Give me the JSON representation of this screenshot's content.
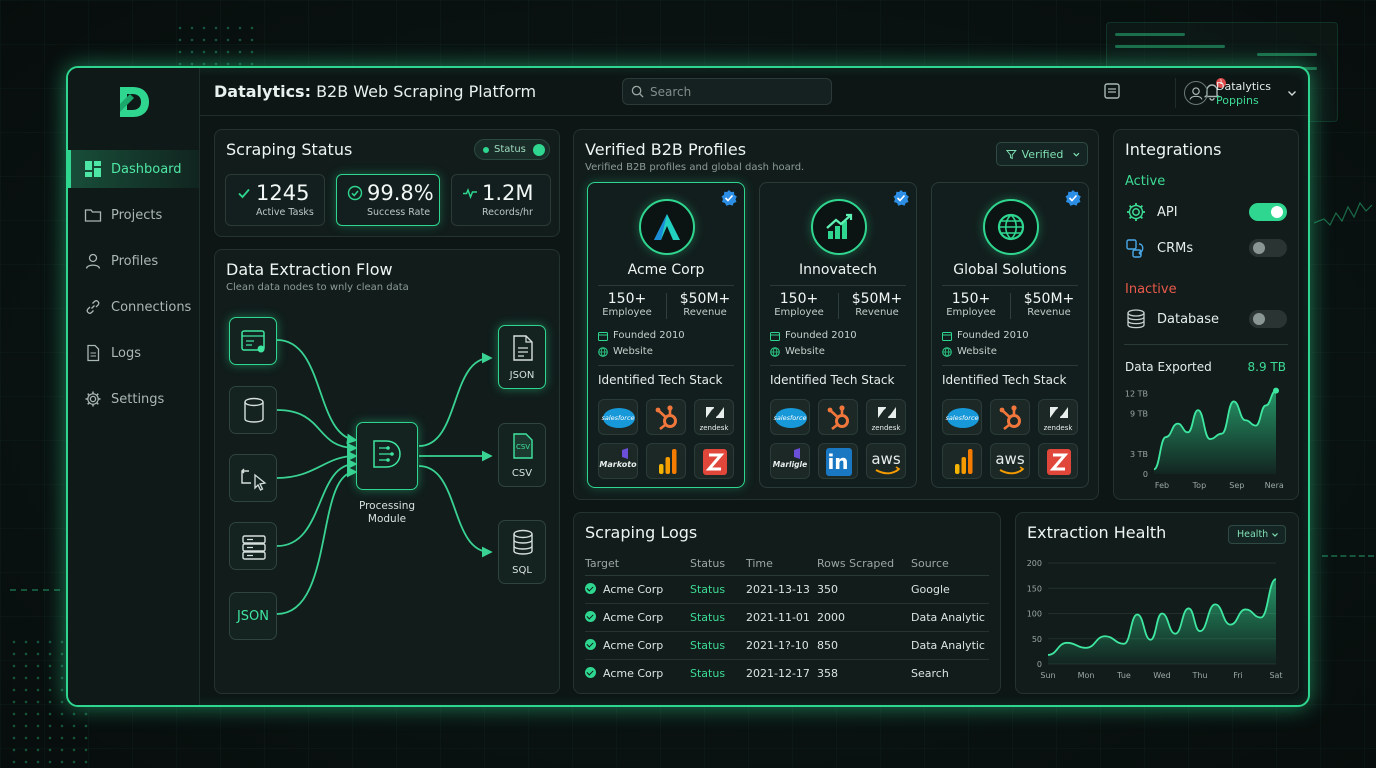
{
  "app": {
    "brand": "Datalytics:",
    "title": "B2B Web Scraping Platform",
    "search_placeholder": "Search",
    "notification_count": "1",
    "user_name": "Datalytics",
    "user_sub": "Poppins"
  },
  "colors": {
    "accent": "#2fd68f",
    "danger": "#e04a4a",
    "panel": "#111c1b"
  },
  "sidebar": {
    "items": [
      {
        "label": "Dashboard",
        "icon": "dashboard-icon",
        "active": true
      },
      {
        "label": "Projects",
        "icon": "folder-icon"
      },
      {
        "label": "Profiles",
        "icon": "user-icon"
      },
      {
        "label": "Connections",
        "icon": "link-icon"
      },
      {
        "label": "Logs",
        "icon": "document-icon"
      },
      {
        "label": "Settings",
        "icon": "gear-icon"
      }
    ]
  },
  "scraping_status": {
    "title": "Scraping Status",
    "pill_label": "Status",
    "stats": [
      {
        "value": "1245",
        "label": "Active Tasks",
        "icon": "check-icon"
      },
      {
        "value": "99.8%",
        "label": "Success Rate",
        "icon": "check-circle-icon"
      },
      {
        "value": "1.2M",
        "label": "Records/hr",
        "icon": "pulse-icon"
      }
    ]
  },
  "flow": {
    "title": "Data Extraction Flow",
    "subtitle": "Clean data nodes to wnly clean data",
    "sources": [
      {
        "icon": "browser-code-icon"
      },
      {
        "icon": "database-icon"
      },
      {
        "icon": "cursor-icon"
      },
      {
        "icon": "server-icon"
      },
      {
        "icon": "json-text-icon",
        "text": "JSON"
      }
    ],
    "processor": {
      "label_line1": "Processing",
      "label_line2": "Module"
    },
    "outputs": [
      {
        "label": "JSON",
        "icon": "file-icon"
      },
      {
        "label": "CSV",
        "icon": "csv-file-icon",
        "badge": "CSV"
      },
      {
        "label": "SQL",
        "icon": "database-icon"
      }
    ]
  },
  "profiles": {
    "title": "Verified B2B Profiles",
    "subtitle": "Verified B2B profiles and global dash hoard.",
    "filter_label": "Verified",
    "stack_title": "Identified Tech Stack",
    "cards": [
      {
        "name": "Acme Corp",
        "logo": "acme-a-icon",
        "employees": "150+",
        "employees_label": "Employee",
        "revenue": "$50M+",
        "revenue_label": "Revenue",
        "founded": "Founded 2010",
        "website": "Website",
        "stack": [
          "salesforce",
          "hubspot",
          "zendesk",
          "marketo",
          "analytics",
          "zapier"
        ]
      },
      {
        "name": "Innovatech",
        "logo": "growth-chart-icon",
        "employees": "150+",
        "employees_label": "Employee",
        "revenue": "$50M+",
        "revenue_label": "Revenue",
        "founded": "Founded 2010",
        "website": "Website",
        "stack": [
          "salesforce",
          "hubspot",
          "zendesk",
          "marketo",
          "linkedin",
          "aws"
        ]
      },
      {
        "name": "Global Solutions",
        "logo": "globe-icon",
        "employees": "150+",
        "employees_label": "Employee",
        "revenue": "$50M+",
        "revenue_label": "Revenue",
        "founded": "Founded 2010",
        "website": "Website",
        "stack": [
          "salesforce",
          "hubspot",
          "zendesk",
          "analytics",
          "aws",
          "zapier"
        ]
      }
    ],
    "tech_text": {
      "salesforce": "salesforce",
      "zendesk": "zendesk",
      "marketo_1": "Markoto",
      "marketo_2": "Marligle",
      "linkedin": "in",
      "aws": "aws"
    }
  },
  "integrations": {
    "title": "Integrations",
    "active_label": "Active",
    "inactive_label": "Inactive",
    "items": [
      {
        "label": "API",
        "icon": "gear-icon",
        "enabled": true
      },
      {
        "label": "CRMs",
        "icon": "sync-icon",
        "enabled": false
      },
      {
        "label": "Database",
        "icon": "database-icon",
        "enabled": false
      }
    ],
    "export_label": "Data Exported",
    "export_value": "8.9 TB"
  },
  "logs": {
    "title": "Scraping Logs",
    "columns": [
      "Target",
      "Status",
      "Time",
      "Rows Scraped",
      "Source"
    ],
    "rows": [
      {
        "target": "Acme Corp",
        "status": "Status",
        "time": "2021-13-13",
        "rows": "350",
        "source": "Google"
      },
      {
        "target": "Acme Corp",
        "status": "Status",
        "time": "2021-11-01",
        "rows": "2000",
        "source": "Data Analytic"
      },
      {
        "target": "Acme Corp",
        "status": "Status",
        "time": "2021-1?-10",
        "rows": "850",
        "source": "Data Analytic"
      },
      {
        "target": "Acme Corp",
        "status": "Status",
        "time": "2021-12-17",
        "rows": "358",
        "source": "Search"
      }
    ]
  },
  "health": {
    "title": "Extraction Health",
    "dropdown_label": "Health"
  },
  "chart_data": [
    {
      "type": "area",
      "title": "",
      "categories": [
        "Feb",
        "Top",
        "Sep",
        "Nera"
      ],
      "x": [
        0,
        0.35,
        0.7,
        1.0,
        1.3,
        1.65,
        2.0,
        2.35,
        2.7,
        3.0,
        3.3,
        3.6
      ],
      "values": [
        0.7,
        5.5,
        7.5,
        6.2,
        9.5,
        5.2,
        6.0,
        10.8,
        8.0,
        7.2,
        10.2,
        12.4
      ],
      "yticks": [
        "0",
        "3 TB",
        "9 TB",
        "12 TB"
      ],
      "ylim": [
        0,
        12.5
      ],
      "grid": false
    },
    {
      "type": "area",
      "title": "",
      "categories": [
        "Sun",
        "Mon",
        "Tue",
        "Wed",
        "Thu",
        "Fri",
        "Sat"
      ],
      "x": [
        0,
        0.5,
        1.0,
        1.5,
        2.0,
        2.35,
        2.7,
        3.0,
        3.35,
        3.7,
        4.0,
        4.4,
        4.8,
        5.2,
        5.6,
        6.0
      ],
      "values": [
        18,
        42,
        32,
        55,
        40,
        98,
        48,
        100,
        60,
        110,
        65,
        118,
        78,
        108,
        92,
        168
      ],
      "yticks": [
        "0",
        "50",
        "100",
        "150",
        "200"
      ],
      "ylim": [
        0,
        200
      ],
      "grid": true
    }
  ]
}
